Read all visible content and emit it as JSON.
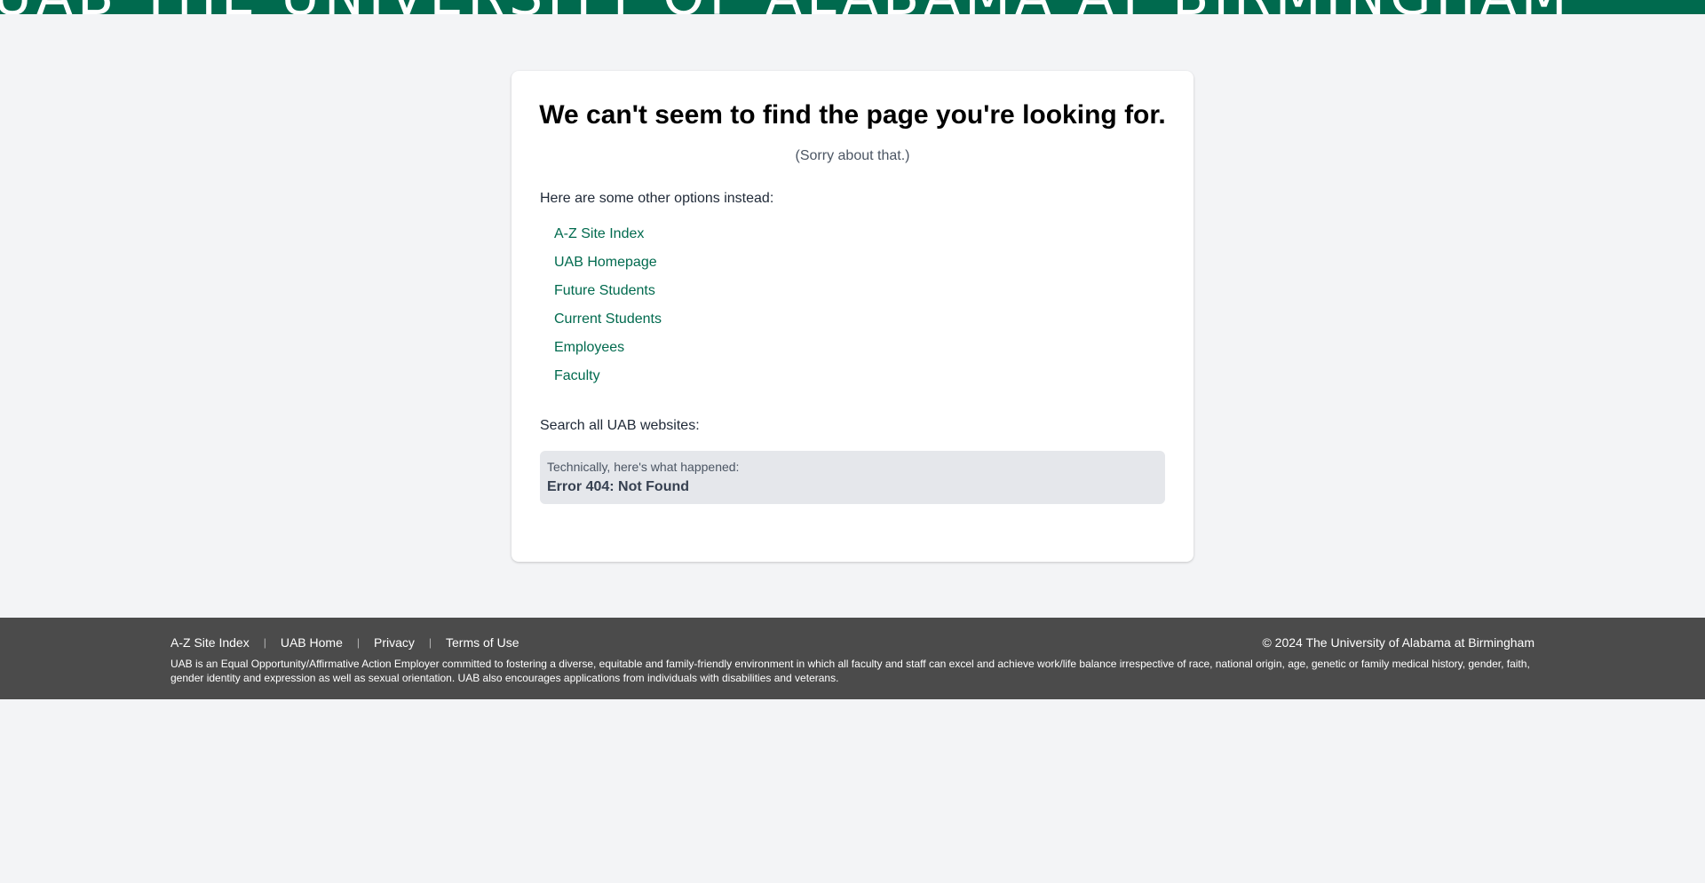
{
  "banner": {
    "text": "UAB THE UNIVERSITY OF ALABAMA AT BIRMINGHAM"
  },
  "main": {
    "title": "We can't seem to find the page you're looking for.",
    "subtitle": "(Sorry about that.)",
    "options_intro": "Here are some other options instead:",
    "options": [
      {
        "label": "A-Z Site Index"
      },
      {
        "label": "UAB Homepage"
      },
      {
        "label": "Future Students"
      },
      {
        "label": "Current Students"
      },
      {
        "label": "Employees"
      },
      {
        "label": "Faculty"
      }
    ],
    "search_label": "Search all UAB websites:",
    "error": {
      "caption": "Technically, here's what happened:",
      "code": "Error 404: Not Found"
    }
  },
  "footer": {
    "links": [
      {
        "label": "A-Z Site Index"
      },
      {
        "label": "UAB Home"
      },
      {
        "label": "Privacy"
      },
      {
        "label": "Terms of Use"
      }
    ],
    "separator": "|",
    "copyright": "© 2024 The University of Alabama at Birmingham",
    "eeo": "UAB is an Equal Opportunity/Affirmative Action Employer committed to fostering a diverse, equitable and family-friendly environment in which all faculty and staff can excel and achieve work/life balance irrespective of race, national origin, age, genetic or family medical history, gender, faith, gender identity and expression as well as sexual orientation. UAB also encourages applications from individuals with disabilities and veterans."
  },
  "colors": {
    "brand_green": "#006a4e",
    "footer_bg": "#4b4b4b",
    "page_bg": "#f3f4f6"
  }
}
